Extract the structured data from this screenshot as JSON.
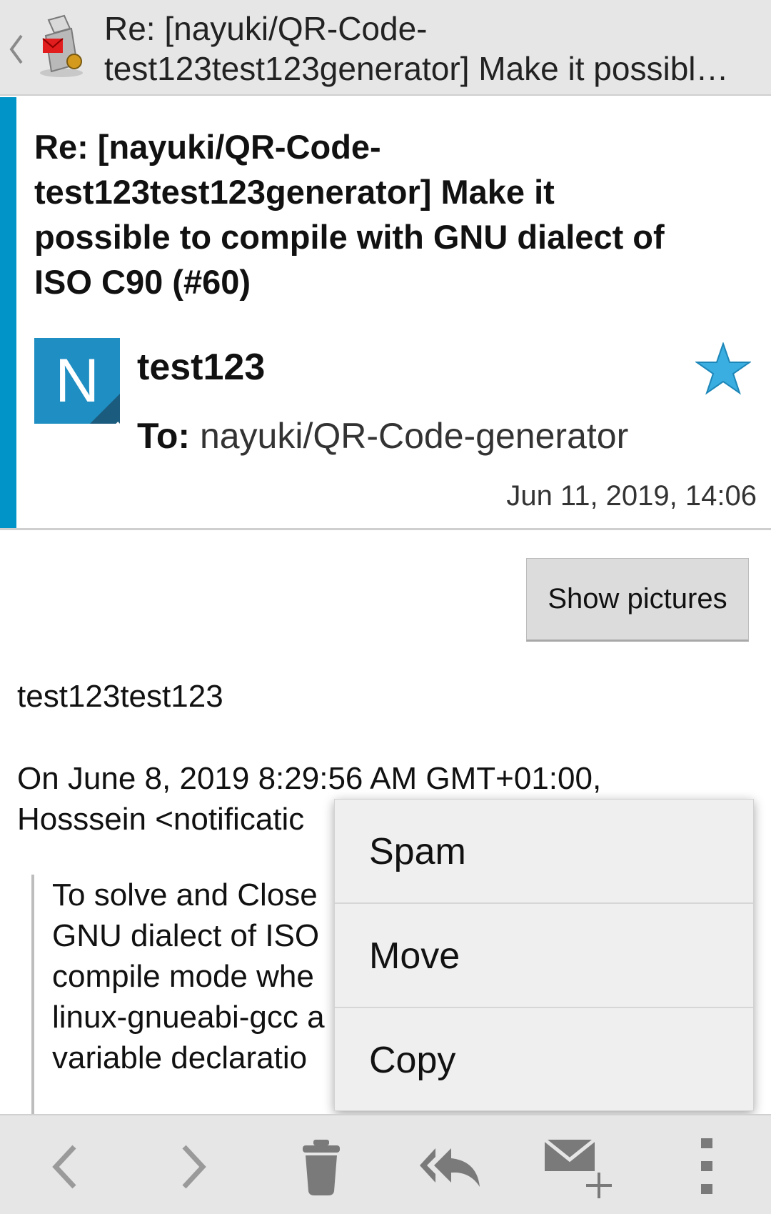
{
  "actionbar": {
    "title_line1": "Re: [nayuki/QR-Code-",
    "title_line2": "test123test123generator] Make it possibl…"
  },
  "header": {
    "subject_lines": [
      "Re: [nayuki/QR-Code-",
      "test123test123generator] Make it",
      "possible to compile with GNU dialect of",
      "ISO C90 (#60)"
    ],
    "avatar_letter": "N",
    "sender": "test123",
    "to_label": "To:",
    "to_value": "nayuki/QR-Code-generator",
    "date": "Jun 11, 2019, 14:06",
    "accent_color": "#0094c8",
    "star_color": "#3aaee0"
  },
  "show_pictures_label": "Show pictures",
  "body": {
    "line1": "test123test123",
    "line2": "On June 8, 2019 8:29:56 AM GMT+01:00,",
    "line3": "Hosssein <notificatic",
    "quote_lines": [
      "To solve and Close",
      "GNU dialect of ISO",
      "compile mode whe",
      "linux-gnueabi-gcc a",
      "variable declaratio"
    ]
  },
  "context_menu": {
    "items": [
      "Spam",
      "Move",
      "Copy"
    ]
  },
  "bottom_bar": {
    "icons": [
      "previous-icon",
      "next-icon",
      "trash-icon",
      "reply-all-icon",
      "compose-icon",
      "overflow-menu-icon"
    ]
  }
}
